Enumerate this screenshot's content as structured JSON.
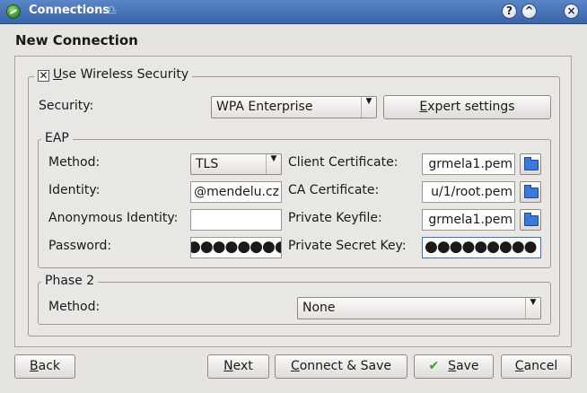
{
  "window": {
    "title": "Connections",
    "buttons": [
      "?",
      "^",
      "×"
    ]
  },
  "dialog": {
    "heading": "New Connection"
  },
  "wireless_security": {
    "checkbox_checked": true,
    "checkbox_mark": "✕",
    "label_prefix": "",
    "label_access": "U",
    "label_rest": "se Wireless Security"
  },
  "security": {
    "label": "Security:",
    "value": "WPA Enterprise",
    "expert_access": "E",
    "expert_rest": "xpert settings"
  },
  "eap": {
    "legend": "EAP",
    "method_label": "Method:",
    "method_value": "TLS",
    "identity_label": "Identity:",
    "identity_value": "@mendelu.cz",
    "anon_label": "Anonymous Identity:",
    "anon_value": "",
    "password_label": "Password:",
    "password_value": "●●●●●●●●●",
    "client_cert_label": "Client Certificate:",
    "client_cert_value": "grmela1.pem",
    "ca_cert_label": "CA Certificate:",
    "ca_cert_value": "u/1/root.pem",
    "private_key_label": "Private Keyfile:",
    "private_key_value": "grmela1.pem",
    "private_secret_label": "Private Secret Key:",
    "private_secret_value": "●●●●●●●●●"
  },
  "phase2": {
    "legend": "Phase 2",
    "method_label": "Method:",
    "method_value": "None"
  },
  "footer": {
    "back_access": "B",
    "back_rest": "ack",
    "next_access": "N",
    "next_rest": "ext",
    "connect_save_access": "C",
    "connect_save_rest": "onnect & Save",
    "save_access": "S",
    "save_rest": "ave",
    "cancel_access": "C",
    "cancel_rest": "ancel"
  }
}
